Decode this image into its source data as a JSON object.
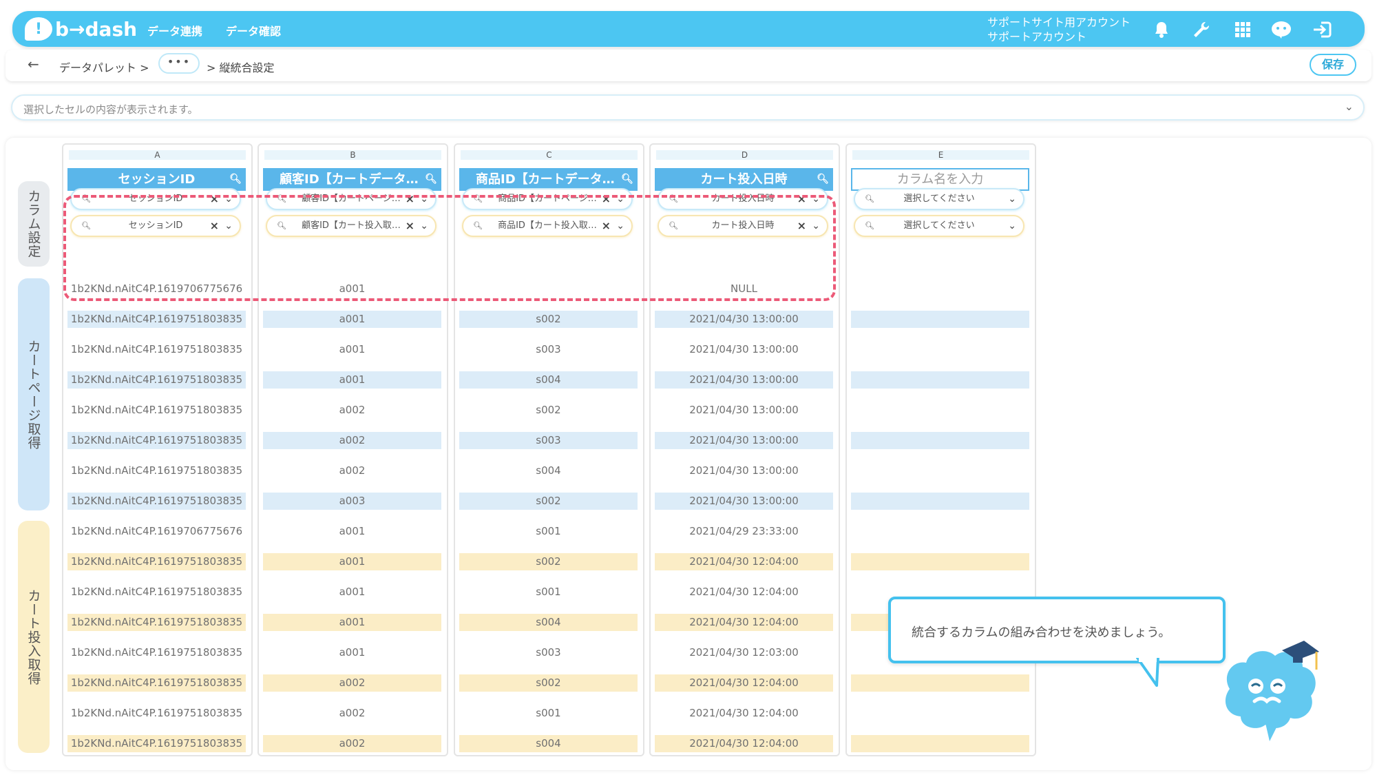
{
  "header": {
    "logo_text": "b→dash",
    "nav": [
      "データ連携",
      "データ確認"
    ],
    "account_line1": "サポートサイト用アカウント",
    "account_line2": "サポートアカウント"
  },
  "breadcrumb": {
    "back_glyph": "←",
    "item1": "データパレット >",
    "more": "•••",
    "current": "> 縦統合設定",
    "save_label": "保存"
  },
  "cellbar": {
    "placeholder": "選択したセルの内容が表示されます。",
    "chevron": "⌄"
  },
  "side_tabs": [
    "カラム設定",
    "カートページ取得",
    "カート投入取得"
  ],
  "columns": [
    {
      "letter": "A",
      "header": "セッションID",
      "select1": "セッションID",
      "select2": "セッションID",
      "cells": [
        "1b2KNd.nAitC4P.1619706775676",
        "1b2KNd.nAitC4P.1619751803835",
        "1b2KNd.nAitC4P.1619751803835",
        "1b2KNd.nAitC4P.1619751803835",
        "1b2KNd.nAitC4P.1619751803835",
        "1b2KNd.nAitC4P.1619751803835",
        "1b2KNd.nAitC4P.1619751803835",
        "1b2KNd.nAitC4P.1619751803835",
        "1b2KNd.nAitC4P.1619706775676",
        "1b2KNd.nAitC4P.1619751803835",
        "1b2KNd.nAitC4P.1619751803835",
        "1b2KNd.nAitC4P.1619751803835",
        "1b2KNd.nAitC4P.1619751803835",
        "1b2KNd.nAitC4P.1619751803835",
        "1b2KNd.nAitC4P.1619751803835",
        "1b2KNd.nAitC4P.1619751803835"
      ]
    },
    {
      "letter": "B",
      "header": "顧客ID【カートデータ全…",
      "select1": "顧客ID【カートページ…",
      "select2": "顧客ID【カート投入取…",
      "cells": [
        "a001",
        "a001",
        "a001",
        "a001",
        "a002",
        "a002",
        "a002",
        "a003",
        "a001",
        "a001",
        "a001",
        "a001",
        "a001",
        "a002",
        "a002",
        "a002"
      ]
    },
    {
      "letter": "C",
      "header": "商品ID【カートデータ全…",
      "select1": "商品ID【カートページ…",
      "select2": "商品ID【カート投入取…",
      "cells": [
        "",
        "s002",
        "s003",
        "s004",
        "s002",
        "s003",
        "s004",
        "s002",
        "s001",
        "s002",
        "s001",
        "s004",
        "s003",
        "s002",
        "s001",
        "s004"
      ]
    },
    {
      "letter": "D",
      "header": "カート投入日時",
      "select1": "カート投入日時",
      "select2": "カート投入日時",
      "cells": [
        "NULL",
        "2021/04/30 13:00:00",
        "2021/04/30 13:00:00",
        "2021/04/30 13:00:00",
        "2021/04/30 13:00:00",
        "2021/04/30 13:00:00",
        "2021/04/30 13:00:00",
        "2021/04/30 13:00:00",
        "2021/04/29 23:33:00",
        "2021/04/30 12:04:00",
        "2021/04/30 12:04:00",
        "2021/04/30 12:04:00",
        "2021/04/30 12:03:00",
        "2021/04/30 12:04:00",
        "2021/04/30 12:04:00",
        "2021/04/30 12:04:00"
      ]
    },
    {
      "letter": "E",
      "header_placeholder": "カラム名を入力",
      "select1": "選択してください",
      "select2": "選択してください",
      "cells": [
        "",
        "",
        "",
        "",
        "",
        "",
        "",
        "",
        "",
        "",
        "",
        "",
        "",
        "",
        "",
        ""
      ]
    }
  ],
  "row_styles": [
    "none",
    "blue",
    "none",
    "blue",
    "none",
    "blue",
    "none",
    "blue",
    "none",
    "yellow",
    "none",
    "yellow",
    "none",
    "yellow",
    "none",
    "yellow"
  ],
  "tooltip": {
    "text": "統合するカラムの組み合わせを決めましょう。"
  },
  "colors": {
    "brand": "#4cc6f2",
    "header_blue": "#5ab6ea",
    "row_blue": "#dcecf8",
    "row_yellow": "#fbedc6",
    "highlight_dashed": "#ec5a78"
  }
}
